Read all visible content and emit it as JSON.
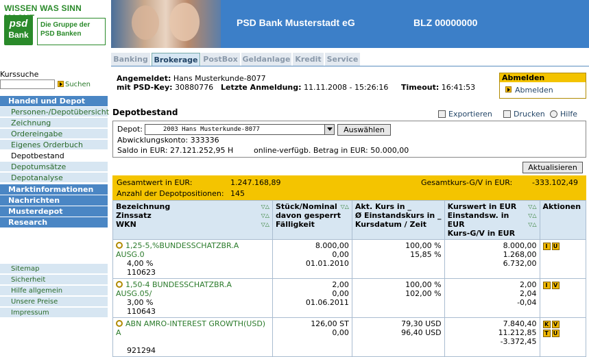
{
  "header": {
    "slogan": "WISSEN WAS SINN MACHT",
    "logo_line1": "psd",
    "logo_line2": "Bank",
    "group_text": "Die Gruppe der PSD Banken",
    "bank_name": "PSD Bank Musterstadt eG",
    "blz": "BLZ 00000000"
  },
  "tabs": [
    "Banking",
    "Brokerage",
    "PostBox",
    "Geldanlage",
    "Kredit",
    "Service"
  ],
  "active_tab": "Brokerage",
  "sidebar": {
    "search_label": "Kurssuche",
    "search_value": "",
    "search_link": "Suchen",
    "sections": [
      {
        "title": "Handel und Depot",
        "items": [
          "Personen-/Depotübersicht",
          "Zeichnung",
          "Ordereingabe",
          "Eigenes Orderbuch",
          "Depotbestand",
          "Depotumsätze",
          "Depotanalyse"
        ]
      },
      {
        "title": "Marktinformationen",
        "items": []
      },
      {
        "title": "Nachrichten",
        "items": []
      },
      {
        "title": "Musterdepot",
        "items": []
      },
      {
        "title": "Research",
        "items": []
      }
    ],
    "active_item": "Depotbestand",
    "footer": [
      "Sitemap",
      "Sicherheit",
      "Hilfe allgemein",
      "Unsere Preise",
      "Impressum"
    ]
  },
  "login": {
    "angemeldet_label": "Angemeldet:",
    "angemeldet_value": "Hans Musterkunde-8077",
    "psdkey_label": "mit PSD-Key:",
    "psdkey_value": "30880776",
    "last_label": "Letzte Anmeldung:",
    "last_value": "11.11.2008 - 15:26:16",
    "timeout_label": "Timeout:",
    "timeout_value": "16:41:53"
  },
  "abmelden": {
    "title": "Abmelden",
    "link": "Abmelden"
  },
  "depot": {
    "heading": "Depotbestand",
    "export": "Exportieren",
    "print": "Drucken",
    "help": "Hilfe",
    "depot_label": "Depot:",
    "depot_selected": "2003  Hans Musterkunde-8077",
    "select_button": "Auswählen",
    "abwicklung": "Abwicklungskonto:  333336",
    "saldo": "Saldo in EUR:  27.121.252,95 H",
    "online": "online-verfügb. Betrag in EUR:  50.000,00",
    "refresh_button": "Aktualisieren"
  },
  "summary": {
    "gesamtwert_label": "Gesamtwert in EUR:",
    "gesamtwert_value": "1.247.168,89",
    "gv_label": "Gesamtkurs-G/V in EUR:",
    "gv_value": "-333.102,49",
    "anzahl_label": "Anzahl der Depotpositionen:",
    "anzahl_value": "145"
  },
  "table": {
    "headers": [
      [
        "Bezeichnung",
        "Zinssatz",
        "WKN"
      ],
      [
        "Stück/Nominal",
        "davon gesperrt",
        "Fälligkeit"
      ],
      [
        "Akt. Kurs in _",
        "Ø Einstandskurs in _",
        "Kursdatum / Zeit"
      ],
      [
        "Kurswert in EUR",
        "Einstandsw. in EUR",
        "Kurs-G/V in EUR"
      ],
      [
        "Aktionen"
      ]
    ],
    "rows": [
      {
        "name": "1,25-5,%BUNDESSCHATZBR.A AUSG.0",
        "zins": "4,00 %",
        "wkn": "110623",
        "stueck": "8.000,00",
        "gesperrt": "0,00",
        "faellig": "01.01.2010",
        "kurs": "100,00 %",
        "einstand": "15,85 %",
        "datum": "",
        "kurswert": "8.000,00",
        "einstandsw": "1.268,00",
        "gv": "6.732,00",
        "actions": [
          "I",
          "U"
        ]
      },
      {
        "name": "1,50-4 BUNDESSCHATZBR.A AUSG.05/",
        "zins": "3,00 %",
        "wkn": "110643",
        "stueck": "2,00",
        "gesperrt": "0,00",
        "faellig": "01.06.2011",
        "kurs": "100,00 %",
        "einstand": "102,00 %",
        "datum": "",
        "kurswert": "2,00",
        "einstandsw": "2,04",
        "gv": "-0,04",
        "actions": [
          "I",
          "V"
        ]
      },
      {
        "name": "ABN AMRO-INTEREST GROWTH(USD) A",
        "zins": "",
        "wkn": "921294",
        "stueck": "126,00 ST",
        "gesperrt": "0,00",
        "faellig": "",
        "kurs": "79,30 USD",
        "einstand": "96,40 USD",
        "datum": "",
        "kurswert": "7.840,40",
        "einstandsw": "11.212,85",
        "gv": "-3.372,45",
        "actions": [
          "K",
          "V",
          "T",
          "U"
        ]
      }
    ]
  }
}
